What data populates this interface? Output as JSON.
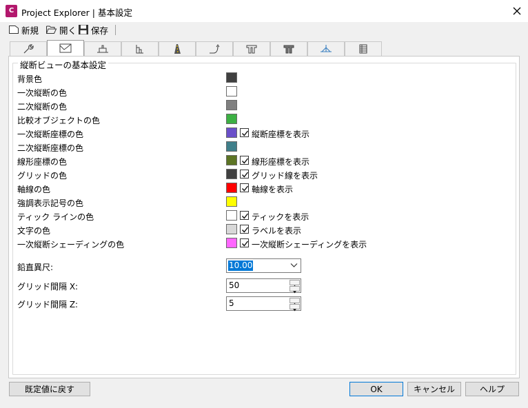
{
  "window": {
    "title": "Project Explorer | 基本設定",
    "app_icon_letter": "C"
  },
  "toolbar": {
    "new_label": "新規",
    "open_label": "開く",
    "save_label": "保存"
  },
  "tabs": [
    {
      "icon": "wrench-icon",
      "active": false
    },
    {
      "icon": "profile-view-icon",
      "active": true
    },
    {
      "icon": "section-view-icon",
      "active": false
    },
    {
      "icon": "sheet-icon",
      "active": false
    },
    {
      "icon": "road-icon",
      "active": false
    },
    {
      "icon": "alignment-icon",
      "active": false
    },
    {
      "icon": "structure-icon",
      "active": false
    },
    {
      "icon": "structure-alt-icon",
      "active": false
    },
    {
      "icon": "baseline-icon",
      "active": false
    },
    {
      "icon": "table-icon",
      "active": false
    }
  ],
  "group": {
    "title": "縦断ビューの基本設定"
  },
  "settings": [
    {
      "label": "背景色",
      "color": "#404040",
      "checkbox": null
    },
    {
      "label": "一次縦断の色",
      "color": "#ffffff",
      "checkbox": null
    },
    {
      "label": "二次縦断の色",
      "color": "#808080",
      "checkbox": null
    },
    {
      "label": "比較オブジェクトの色",
      "color": "#3cb043",
      "checkbox": null
    },
    {
      "label": "一次縦断座標の色",
      "color": "#6a4fc9",
      "checkbox": {
        "label": "縦断座標を表示",
        "checked": true
      }
    },
    {
      "label": "二次縦断座標の色",
      "color": "#3f7f8a",
      "checkbox": null
    },
    {
      "label": "線形座標の色",
      "color": "#5c7424",
      "checkbox": {
        "label": "線形座標を表示",
        "checked": true
      }
    },
    {
      "label": "グリッドの色",
      "color": "#404040",
      "checkbox": {
        "label": "グリッド線を表示",
        "checked": true
      }
    },
    {
      "label": "軸線の色",
      "color": "#ff0000",
      "checkbox": {
        "label": "軸線を表示",
        "checked": true
      }
    },
    {
      "label": "強調表示記号の色",
      "color": "#ffff00",
      "checkbox": null
    },
    {
      "label": "ティック ラインの色",
      "color": "#ffffff",
      "checkbox": {
        "label": "ティックを表示",
        "checked": true
      }
    },
    {
      "label": "文字の色",
      "color": "#d8d8d8",
      "checkbox": {
        "label": "ラベルを表示",
        "checked": true
      }
    },
    {
      "label": "一次縦断シェーディングの色",
      "color": "#ff66ff",
      "checkbox": {
        "label": "一次縦断シェーディングを表示",
        "checked": true
      }
    }
  ],
  "fields": {
    "vertical_exaggeration": {
      "label": "鉛直異尺:",
      "value": "10.00"
    },
    "grid_x": {
      "label": "グリッド間隔 X:",
      "value": "50"
    },
    "grid_z": {
      "label": "グリッド間隔 Z:",
      "value": "5"
    }
  },
  "buttons": {
    "reset": "既定値に戻す",
    "ok": "OK",
    "cancel": "キャンセル",
    "help": "ヘルプ"
  }
}
